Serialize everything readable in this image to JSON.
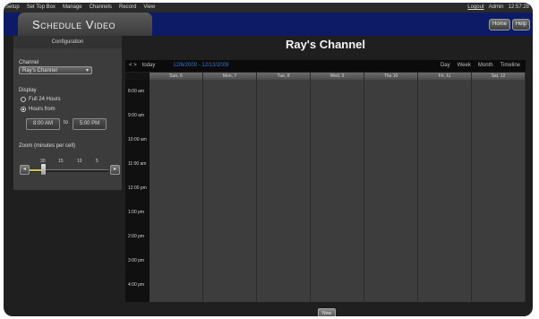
{
  "topnav": {
    "items": [
      "Setup",
      "Set Top Box",
      "Manage",
      "Channels",
      "Record",
      "View"
    ],
    "logout": "Logout",
    "user": "Admin",
    "clock": "12:57:28"
  },
  "header": {
    "title": "Schedule Video",
    "home_label": "Home",
    "help_label": "Help",
    "bar_color": "#0d1a66"
  },
  "sidebar": {
    "heading": "Configuration",
    "channel_label": "Channel",
    "channel_value": "Ray's Channel",
    "display_label": "Display",
    "option_full": "Full 24 Hours",
    "option_hours": "Hours from",
    "time_from": "8:00 AM",
    "to_label": "to",
    "time_to": "5:00 PM",
    "zoom_label": "Zoom (minutes per cell)",
    "zoom_ticks": [
      "30",
      "15",
      "10",
      "5"
    ],
    "zoom_value": 30
  },
  "main": {
    "channel_title": "Ray's Channel",
    "nav": {
      "arrows": "< >",
      "today": "today",
      "range": "12/6/2009 - 12/13/2009",
      "views": [
        "Day",
        "Week",
        "Month",
        "Timeline"
      ]
    },
    "days": [
      "Sun, 6",
      "Mon, 7",
      "Tue, 8",
      "Wed, 9",
      "Thu 10",
      "Fri, 11",
      "Sat, 12"
    ],
    "times": [
      "8:00 am",
      "9:00 am",
      "10:00 am",
      "11:00 am",
      "12:00 pm",
      "1:00 pm",
      "2:00 pm",
      "3:00 pm",
      "4:00 pm"
    ],
    "now_label": "Now"
  }
}
